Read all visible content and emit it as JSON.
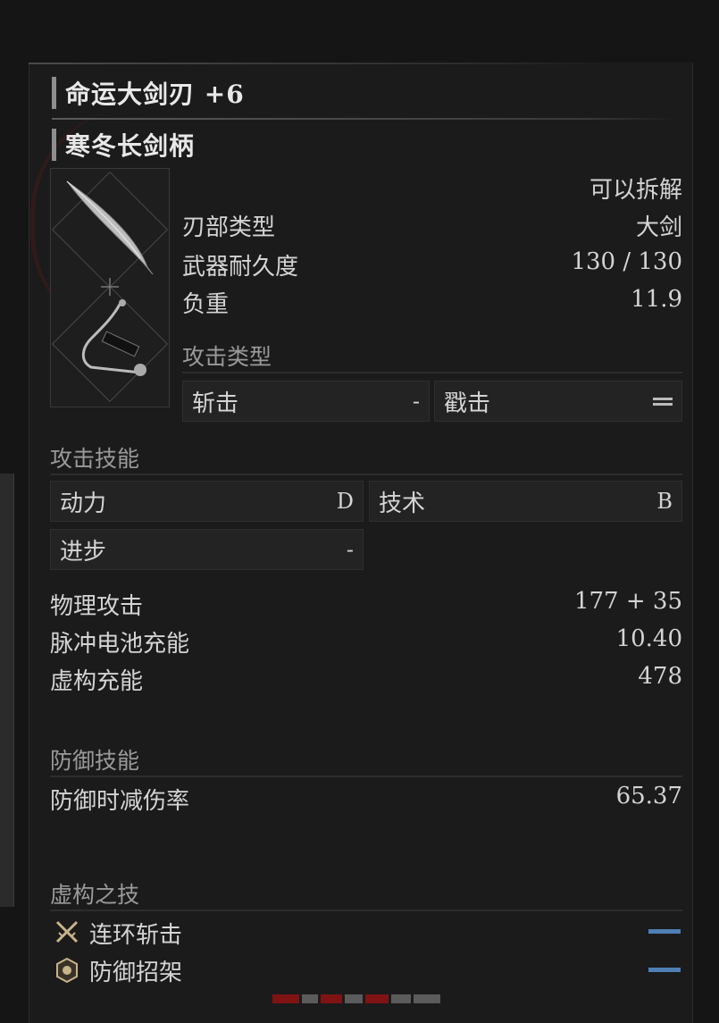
{
  "weapon": {
    "blade_name": "命运大剑刃 +6",
    "handle_name": "寒冬长剑柄",
    "disassemble": "可以拆解",
    "stats": [
      {
        "label": "刃部类型",
        "value": "大剑"
      },
      {
        "label": "武器耐久度",
        "value": "130 / 130"
      },
      {
        "label": "负重",
        "value": "11.9"
      }
    ]
  },
  "attack_type": {
    "label": "攻击类型",
    "slash": {
      "label": "斩击",
      "value": "-"
    },
    "pierce": {
      "label": "戳击",
      "value_icon": "double-bar-icon"
    }
  },
  "attack_skill": {
    "label": "攻击技能",
    "power": {
      "label": "动力",
      "value": "D"
    },
    "technique": {
      "label": "技术",
      "value": "B"
    },
    "advance": {
      "label": "进步",
      "value": "-"
    }
  },
  "attack_stats": [
    {
      "label": "物理攻击",
      "value": "177 + 35"
    },
    {
      "label": "脉冲电池充能",
      "value": "10.40"
    },
    {
      "label": "虚构充能",
      "value": "478"
    }
  ],
  "defense_skill": {
    "label": "防御技能",
    "stat": {
      "label": "防御时减伤率",
      "value": "65.37"
    }
  },
  "fable_arts": {
    "label": "虚构之技",
    "items": [
      {
        "label": "连环斩击",
        "icon": "crossed-swords-icon"
      },
      {
        "label": "防御招架",
        "icon": "shield-emblem-icon"
      }
    ]
  },
  "colors": {
    "accent_blue": "#4f7fb4",
    "watermark_red": "#aa1111"
  }
}
